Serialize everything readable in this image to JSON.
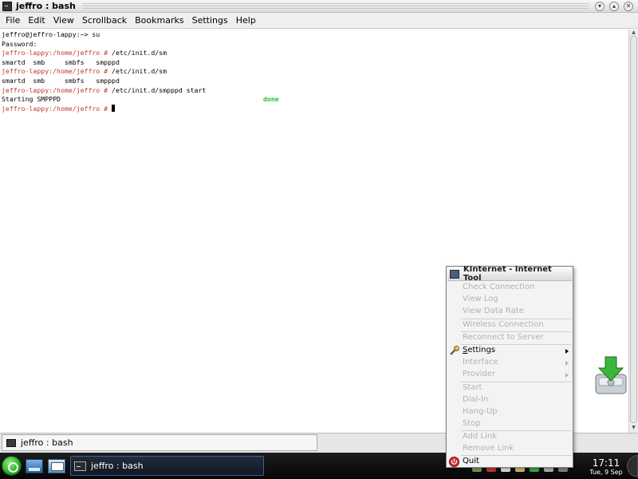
{
  "window": {
    "title": "jeffro : bash",
    "menus": [
      "File",
      "Edit",
      "View",
      "Scrollback",
      "Bookmarks",
      "Settings",
      "Help"
    ]
  },
  "terminal": {
    "lines": [
      {
        "kind": "plain",
        "text": "jeffro@jeffro-lappy:~> su"
      },
      {
        "kind": "plain",
        "text": "Password:"
      },
      {
        "kind": "prompt",
        "prompt": "jeffro-lappy:/home/jeffro #",
        "command": " /etc/init.d/sm"
      },
      {
        "kind": "plain",
        "text": "smartd  smb     smbfs   smpppd"
      },
      {
        "kind": "prompt",
        "prompt": "jeffro-lappy:/home/jeffro #",
        "command": " /etc/init.d/sm"
      },
      {
        "kind": "plain",
        "text": "smartd  smb     smbfs   smpppd"
      },
      {
        "kind": "prompt",
        "prompt": "jeffro-lappy:/home/jeffro #",
        "command": " /etc/init.d/smpppd start"
      },
      {
        "kind": "status",
        "text": "Starting SMPPPD",
        "status": "done"
      },
      {
        "kind": "prompt-cursor",
        "prompt": "jeffro-lappy:/home/jeffro #",
        "command": " "
      }
    ]
  },
  "session_tab": {
    "label": "jeffro : bash"
  },
  "taskbar": {
    "task_label": "jeffro : bash",
    "clock_time": "17:11",
    "clock_date": "Tue, 9 Sep"
  },
  "kinternet_menu": {
    "title": "KInternet - Internet Tool",
    "items": {
      "check_connection": "Check Connection",
      "view_log": "View Log",
      "view_data_rate": "View Data Rate",
      "wireless_connection": "Wireless Connection",
      "reconnect": "Reconnect to Server",
      "settings_first": "S",
      "settings_rest": "ettings",
      "interface": "Interface",
      "provider": "Provider",
      "start": "Start",
      "dial_in": "Dial-In",
      "hang_up": "Hang-Up",
      "stop": "Stop",
      "add_link": "Add Link",
      "remove_link": "Remove Link",
      "quit": "Quit"
    }
  },
  "colors": {
    "prompt": "#c0392b",
    "done": "#21c521",
    "disabled_text": "#b2b2b2"
  }
}
